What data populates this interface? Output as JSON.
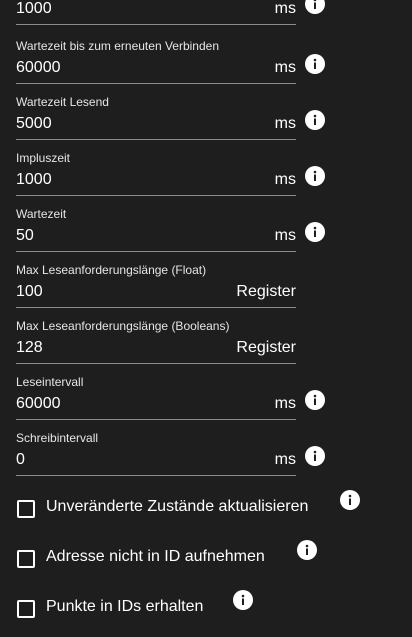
{
  "fields": [
    {
      "label": "",
      "value": "1000",
      "unit": "ms",
      "info": true
    },
    {
      "label": "Wartezeit bis zum erneuten Verbinden",
      "value": "60000",
      "unit": "ms",
      "info": true
    },
    {
      "label": "Wartezeit Lesend",
      "value": "5000",
      "unit": "ms",
      "info": true
    },
    {
      "label": "Impluszeit",
      "value": "1000",
      "unit": "ms",
      "info": true
    },
    {
      "label": "Wartezeit",
      "value": "50",
      "unit": "ms",
      "info": true
    },
    {
      "label": "Max Leseanforderungslänge (Float)",
      "value": "100",
      "unit": "Register",
      "info": false
    },
    {
      "label": "Max Leseanforderungslänge (Booleans)",
      "value": "128",
      "unit": "Register",
      "info": false
    },
    {
      "label": "Leseintervall",
      "value": "60000",
      "unit": "ms",
      "info": true
    },
    {
      "label": "Schreibintervall",
      "value": "0",
      "unit": "ms",
      "info": true
    }
  ],
  "checkboxes": [
    {
      "label": "Unveränderte Zustände aktualisieren",
      "checked": false
    },
    {
      "label": "Adresse nicht in ID aufnehmen",
      "checked": false
    },
    {
      "label": "Punkte in IDs erhalten",
      "checked": false
    }
  ],
  "icons": {
    "info": "info-circle-icon"
  },
  "colors": {
    "background": "#1e1e1e",
    "text": "#ffffff",
    "underline": "#8c8c8c"
  }
}
